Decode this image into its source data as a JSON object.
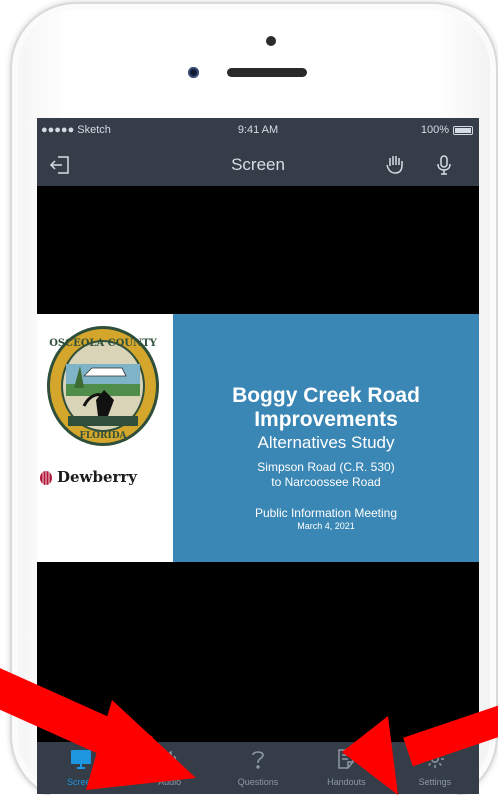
{
  "status_bar": {
    "carrier": "●●●●● Sketch",
    "time": "9:41 AM",
    "battery": "100%"
  },
  "nav_bar": {
    "title": "Screen"
  },
  "slide": {
    "title_line1": "Boggy Creek Road",
    "title_line2": "Improvements",
    "subtitle": "Alternatives Study",
    "route_line1": "Simpson Road (C.R. 530)",
    "route_line2": "to Narcoossee Road",
    "meeting": "Public Information Meeting",
    "date": "March 4, 2021",
    "sponsor_logo_text": "Dewberry",
    "seal_text": "OSCEOLA COUNTY FLORIDA"
  },
  "tab_bar": {
    "tabs": [
      {
        "label": "Screen",
        "icon": "monitor-icon",
        "active": true
      },
      {
        "label": "Audio",
        "icon": "speaker-phone-icon",
        "active": false
      },
      {
        "label": "Questions",
        "icon": "question-mark-icon",
        "active": false
      },
      {
        "label": "Handouts",
        "icon": "document-icon",
        "active": false
      },
      {
        "label": "Settings",
        "icon": "gear-icon",
        "active": false
      }
    ]
  },
  "colors": {
    "accent": "#1e96df",
    "chrome": "#353d49",
    "slide_blue": "#3a86b4",
    "annotation_arrow": "#ff0000"
  }
}
